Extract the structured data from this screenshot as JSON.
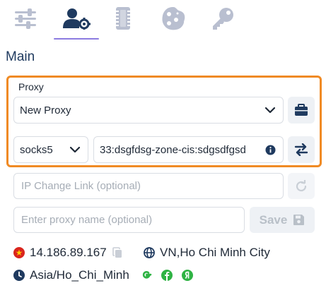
{
  "tabs": [
    {
      "icon": "sliders-icon"
    },
    {
      "icon": "user-settings-icon",
      "active": true
    },
    {
      "icon": "chip-icon"
    },
    {
      "icon": "cookie-icon"
    },
    {
      "icon": "key-icon"
    }
  ],
  "section_title": "Main",
  "proxy": {
    "label": "Proxy",
    "selected_proxy": "New Proxy",
    "protocol": "socks5",
    "proxy_string": "33:dsgfdsg-zone-cis:sdgsdfgsd"
  },
  "ip_change_link": {
    "placeholder": "IP Change Link (optional)",
    "value": ""
  },
  "proxy_name": {
    "placeholder": "Enter proxy name (optional)",
    "value": ""
  },
  "save_label": "Save",
  "info": {
    "ip": "14.186.89.167",
    "location": "VN,Ho Chi Minh City",
    "timezone": "Asia/Ho_Chi_Minh"
  },
  "colors": {
    "accent": "#8b7be0",
    "highlight": "#f08a24",
    "tab_icon": "#b9bfd0",
    "active_tab_icon": "#1f3a5f",
    "green_badge": "#2fb344"
  }
}
